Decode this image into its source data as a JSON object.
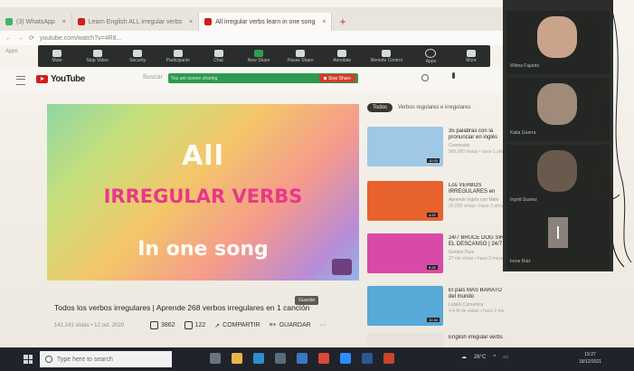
{
  "browser": {
    "tabs": [
      {
        "label": "(3) WhatsApp",
        "color": "#3bb56a"
      },
      {
        "label": "Learn English ALL irregular verbs",
        "color": "#d11d1d"
      },
      {
        "label": "All irregular verbs learn in one song",
        "color": "#d11d1d"
      }
    ],
    "address": "youtube.com/watch?v=4R8...",
    "bookmarks": "Apps"
  },
  "zoom_toolbar": {
    "buttons": [
      "Mute",
      "Stop Video",
      "Security",
      "Participants",
      "Chat",
      "New Share",
      "Pause Share",
      "Annotate",
      "Remote Control",
      "Apps",
      "More"
    ]
  },
  "sharing": {
    "text": "You are screen sharing",
    "stop_label": "Stop Share"
  },
  "youtube": {
    "logo_text": "YouTube",
    "search_placeholder": "Buscar"
  },
  "video": {
    "line1": "All",
    "line2": "IRREGULAR VERBS",
    "line3": "In one song",
    "title": "Todos los verbos irregulares | Aprende 268 verbos irregulares en 1 canción",
    "meta": "141.241 vistas • 12 oct. 2020",
    "tooltip": "Guardar",
    "likes": "3862",
    "dislikes": "122",
    "share_label": "COMPARTIR",
    "save_label": "GUARDAR"
  },
  "chips": {
    "active": "Todos",
    "other": "Verbos regulares e irregulares"
  },
  "suggestions": [
    {
      "title": "35 palabras con la pronunciar en inglés",
      "channel": "Cosmosity",
      "views": "966.000 vistas • hace 1 año",
      "duration": "10:33",
      "thumb": "#9fc8e6"
    },
    {
      "title": "Los VERBOS IRREGULARES en inglés | en 1 canción",
      "channel": "Aprende Inglés con Mahi",
      "views": "20.000 vistas • hace 3 años",
      "duration": "4:22",
      "thumb": "#e8622e"
    },
    {
      "title": "24/7 BRUCE DOG SIR EL DESCANSO | 24/7",
      "channel": "Gordon Ruiz",
      "views": "27 mil vistas • hace 2 meses",
      "duration": "6:24",
      "thumb": "#d94aa8"
    },
    {
      "title": "El país MÁS BARATO del mundo",
      "channel": "Luisito Comunica",
      "views": "4,4 M de vistas • hace 2 meses",
      "duration": "12:40",
      "thumb": "#58a8d8"
    },
    {
      "title": "English irregular verbs",
      "channel": "",
      "views": "",
      "duration": "",
      "thumb": "#e7e2da"
    }
  ],
  "participants": [
    {
      "name": "Wilma Fajardo",
      "face": "#c9a48a"
    },
    {
      "name": "Katia Guerra",
      "face": "#a08a7a"
    },
    {
      "name": "Ingrid Suarez",
      "face": "#6a5a4e"
    },
    {
      "name": "Irene Ruiz",
      "face": "#8a817b"
    }
  ],
  "taskbar": {
    "search_placeholder": "Type here to search",
    "weather": "26°C",
    "time": "19:27",
    "date": "18/12/2021"
  },
  "colors": {
    "youtube_red": "#d11d1d",
    "zoom_green": "#2c9a4f",
    "stop_red": "#d93a2b"
  }
}
